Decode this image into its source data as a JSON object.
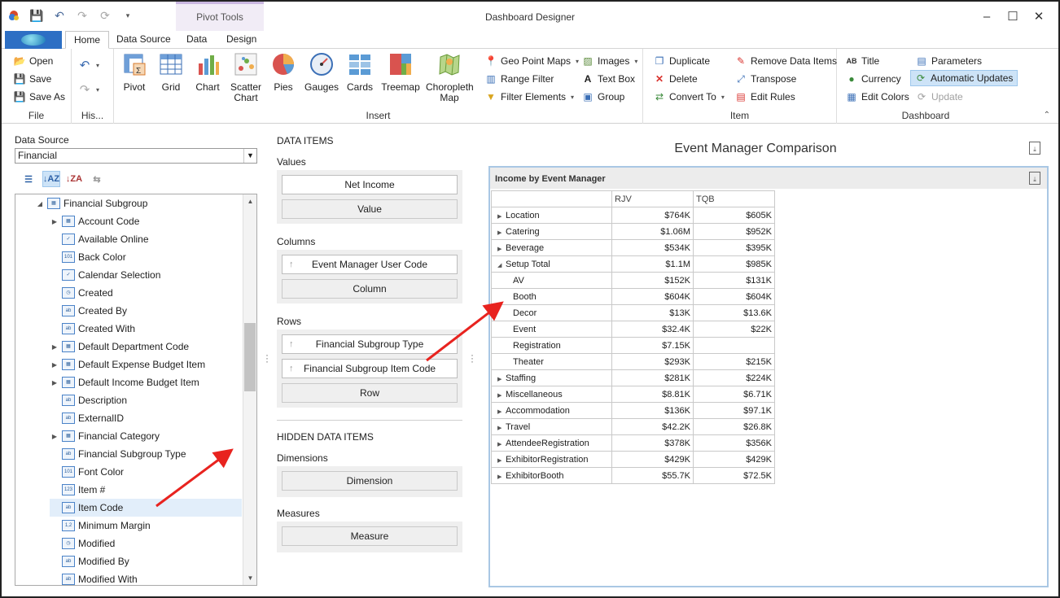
{
  "window": {
    "title": "Dashboard Designer",
    "context_tab_group": "Pivot Tools",
    "controls": [
      "minimize-icon",
      "maximize-icon",
      "close-icon"
    ]
  },
  "tabs": [
    "Home",
    "Data Source",
    "Data",
    "Design"
  ],
  "active_tab": "Home",
  "ribbon": {
    "file": {
      "open": "Open",
      "save": "Save",
      "save_as": "Save As",
      "label": "File"
    },
    "history": {
      "label": "His..."
    },
    "insert": {
      "label": "Insert",
      "pivot": "Pivot",
      "grid": "Grid",
      "chart": "Chart",
      "scatter_chart": "Scatter Chart",
      "pies": "Pies",
      "gauges": "Gauges",
      "cards": "Cards",
      "treemap": "Treemap",
      "choropleth_map": "Choropleth Map",
      "geo_point_maps": "Geo Point Maps",
      "range_filter": "Range Filter",
      "filter_elements": "Filter Elements",
      "images": "Images",
      "text_box": "Text Box",
      "group": "Group"
    },
    "item": {
      "label": "Item",
      "duplicate": "Duplicate",
      "delete": "Delete",
      "convert_to": "Convert To",
      "remove_data_items": "Remove Data Items",
      "transpose": "Transpose",
      "edit_rules": "Edit Rules"
    },
    "dashboard": {
      "label": "Dashboard",
      "title": "Title",
      "currency": "Currency",
      "edit_colors": "Edit Colors",
      "parameters": "Parameters",
      "automatic_updates": "Automatic Updates",
      "update": "Update"
    }
  },
  "data_source": {
    "label": "Data Source",
    "selected": "Financial",
    "tree": [
      {
        "label": "Financial Subgroup",
        "level": 0,
        "expandable": "open",
        "icon": "table-icon"
      },
      {
        "label": "Account Code",
        "level": 1,
        "expandable": "closed",
        "icon": "table-icon"
      },
      {
        "label": "Available Online",
        "level": 1,
        "icon": "boolean-icon"
      },
      {
        "label": "Back Color",
        "level": 1,
        "icon": "number-icon"
      },
      {
        "label": "Calendar Selection",
        "level": 1,
        "icon": "boolean-icon"
      },
      {
        "label": "Created",
        "level": 1,
        "icon": "datetime-icon"
      },
      {
        "label": "Created By",
        "level": 1,
        "icon": "text-icon"
      },
      {
        "label": "Created With",
        "level": 1,
        "icon": "text-icon"
      },
      {
        "label": "Default Department Code",
        "level": 1,
        "expandable": "closed",
        "icon": "table-icon"
      },
      {
        "label": "Default Expense Budget Item",
        "level": 1,
        "expandable": "closed",
        "icon": "table-icon"
      },
      {
        "label": "Default Income Budget Item",
        "level": 1,
        "expandable": "closed",
        "icon": "table-icon"
      },
      {
        "label": "Description",
        "level": 1,
        "icon": "text-icon"
      },
      {
        "label": "ExternalID",
        "level": 1,
        "icon": "text-icon"
      },
      {
        "label": "Financial Category",
        "level": 1,
        "expandable": "closed",
        "icon": "table-icon"
      },
      {
        "label": "Financial Subgroup Type",
        "level": 1,
        "icon": "text-icon"
      },
      {
        "label": "Font Color",
        "level": 1,
        "icon": "number-icon"
      },
      {
        "label": "Item #",
        "level": 1,
        "icon": "integer-icon"
      },
      {
        "label": "Item Code",
        "level": 1,
        "icon": "text-icon",
        "selected": true
      },
      {
        "label": "Minimum Margin",
        "level": 1,
        "icon": "decimal-icon"
      },
      {
        "label": "Modified",
        "level": 1,
        "icon": "datetime-icon"
      },
      {
        "label": "Modified By",
        "level": 1,
        "icon": "text-icon"
      },
      {
        "label": "Modified With",
        "level": 1,
        "icon": "text-icon"
      }
    ]
  },
  "data_items": {
    "header": "DATA ITEMS",
    "values_label": "Values",
    "values_field": "Net Income",
    "values_placeholder": "Value",
    "columns_label": "Columns",
    "columns_field": "Event Manager User Code",
    "columns_placeholder": "Column",
    "rows_label": "Rows",
    "rows_field_1": "Financial Subgroup Type",
    "rows_field_2": "Financial Subgroup Item Code",
    "rows_placeholder": "Row",
    "hidden_header": "HIDDEN DATA ITEMS",
    "dimensions_label": "Dimensions",
    "dimensions_placeholder": "Dimension",
    "measures_label": "Measures",
    "measures_placeholder": "Measure"
  },
  "dashboard": {
    "title": "Event Manager Comparison",
    "item_title": "Income by Event Manager",
    "columns": [
      "RJV",
      "TQB"
    ],
    "rows": [
      {
        "label": "Location",
        "type": "collapsed",
        "values": [
          "$764K",
          "$605K"
        ],
        "selected": true
      },
      {
        "label": "Catering",
        "type": "collapsed",
        "values": [
          "$1.06M",
          "$952K"
        ]
      },
      {
        "label": "Beverage",
        "type": "collapsed",
        "values": [
          "$534K",
          "$395K"
        ]
      },
      {
        "label": "Setup Total",
        "type": "expanded",
        "values": [
          "$1.1M",
          "$985K"
        ]
      },
      {
        "label": "AV",
        "type": "child",
        "values": [
          "$152K",
          "$131K"
        ]
      },
      {
        "label": "Booth",
        "type": "child",
        "values": [
          "$604K",
          "$604K"
        ]
      },
      {
        "label": "Decor",
        "type": "child",
        "values": [
          "$13K",
          "$13.6K"
        ]
      },
      {
        "label": "Event",
        "type": "child",
        "values": [
          "$32.4K",
          "$22K"
        ]
      },
      {
        "label": "Registration",
        "type": "child",
        "values": [
          "$7.15K",
          ""
        ]
      },
      {
        "label": "Theater",
        "type": "child",
        "values": [
          "$293K",
          "$215K"
        ]
      },
      {
        "label": "Staffing",
        "type": "collapsed",
        "values": [
          "$281K",
          "$224K"
        ]
      },
      {
        "label": "Miscellaneous",
        "type": "collapsed",
        "values": [
          "$8.81K",
          "$6.71K"
        ]
      },
      {
        "label": "Accommodation",
        "type": "collapsed",
        "values": [
          "$136K",
          "$97.1K"
        ]
      },
      {
        "label": "Travel",
        "type": "collapsed",
        "values": [
          "$42.2K",
          "$26.8K"
        ]
      },
      {
        "label": "AttendeeRegistration",
        "type": "collapsed",
        "values": [
          "$378K",
          "$356K"
        ]
      },
      {
        "label": "ExhibitorRegistration",
        "type": "collapsed",
        "values": [
          "$429K",
          "$429K"
        ]
      },
      {
        "label": "ExhibitorBooth",
        "type": "collapsed",
        "values": [
          "$55.7K",
          "$72.5K"
        ]
      }
    ]
  },
  "colors": {
    "accent": "#2d6fc4",
    "annotation_arrow": "#e8231f",
    "highlight": "#cde3f7",
    "item_border": "#a9c7e4"
  }
}
